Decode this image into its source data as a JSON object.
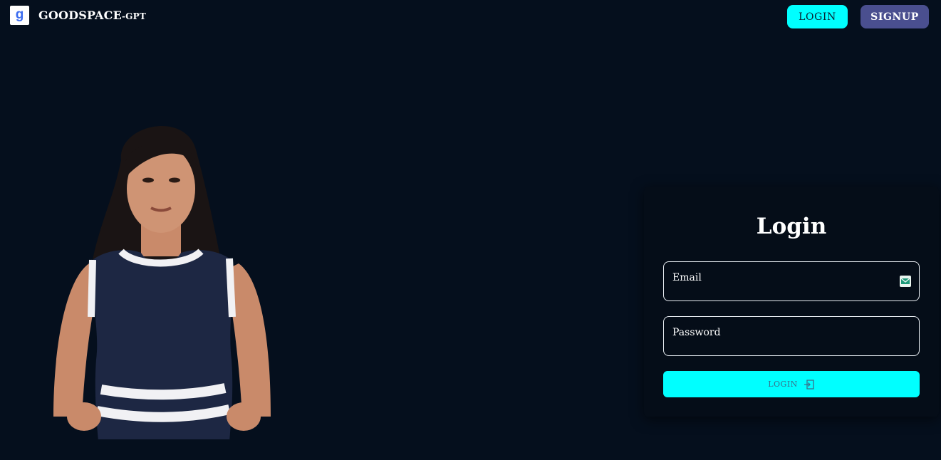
{
  "header": {
    "logo_letter": "g",
    "brand_main": "GOODSPACE",
    "brand_suffix": "-GPT",
    "login_label": "LOGIN",
    "signup_label": "SIGNUP"
  },
  "hero": {
    "icon": "avatar-woman"
  },
  "login_card": {
    "title": "Login",
    "email_label": "Email",
    "email_icon": "mail-icon",
    "password_label": "Password",
    "submit_label": "LOGIN",
    "submit_icon": "login-icon"
  },
  "colors": {
    "background": "#050f1d",
    "accent_cyan": "#00ffff",
    "signup_purple": "#4a4f8f",
    "logo_blue": "#3b6cf0"
  }
}
